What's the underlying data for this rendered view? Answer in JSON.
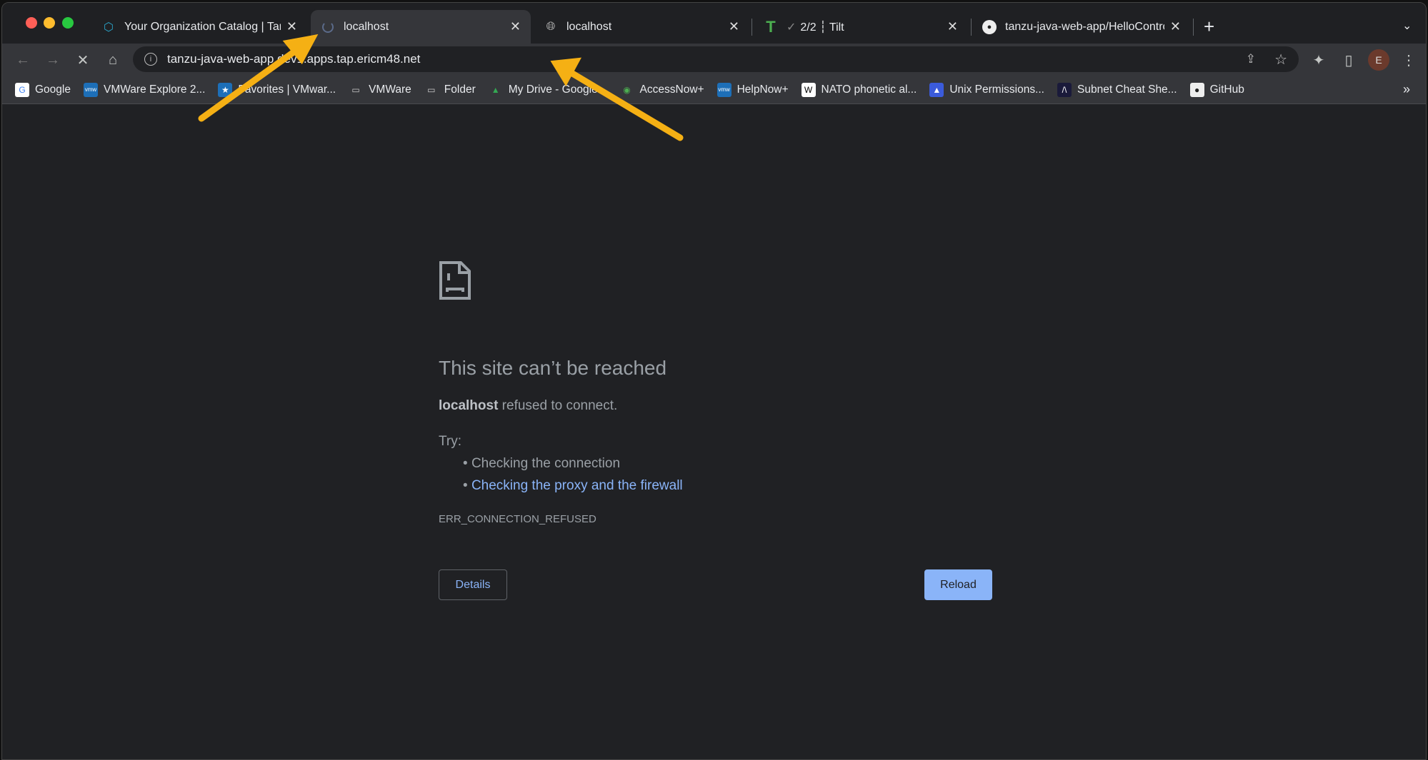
{
  "tabs": [
    {
      "title": "Your Organization Catalog | Tanzu",
      "icon": "tanzu-icon",
      "active": false
    },
    {
      "title": "localhost",
      "icon": "loading-spinner-icon",
      "active": true
    },
    {
      "title": "localhost",
      "icon": "globe-icon",
      "active": false
    },
    {
      "title": "2/2 ┆ Tilt",
      "prefix": "✓",
      "icon": "tilt-icon",
      "active": false
    },
    {
      "title": "tanzu-java-web-app/HelloController",
      "icon": "github-icon",
      "active": false
    }
  ],
  "toolbar": {
    "url": "tanzu-java-web-app.dev1.apps.tap.ericm48.net",
    "profile_initial": "E"
  },
  "bookmarks": [
    {
      "label": "Google",
      "icon": "google-icon"
    },
    {
      "label": "VMWare Explore 2...",
      "icon": "vmware-icon"
    },
    {
      "label": "Favorites | VMwar...",
      "icon": "favorites-icon"
    },
    {
      "label": "VMWare",
      "icon": "folder-icon"
    },
    {
      "label": "Folder",
      "icon": "folder-icon"
    },
    {
      "label": "My Drive - Google...",
      "icon": "google-drive-icon"
    },
    {
      "label": "AccessNow+",
      "icon": "accessnow-icon"
    },
    {
      "label": "HelpNow+",
      "icon": "vmware-icon"
    },
    {
      "label": "NATO phonetic al...",
      "icon": "wikipedia-icon"
    },
    {
      "label": "Unix Permissions...",
      "icon": "unix-icon"
    },
    {
      "label": "Subnet Cheat She...",
      "icon": "subnet-icon"
    },
    {
      "label": "GitHub",
      "icon": "github-icon"
    }
  ],
  "bookmarks_overflow": "»",
  "error": {
    "title": "This site can’t be reached",
    "host": "localhost",
    "message": " refused to connect.",
    "try_label": "Try:",
    "suggestions": [
      "Checking the connection",
      "Checking the proxy and the firewall"
    ],
    "code": "ERR_CONNECTION_REFUSED",
    "details_label": "Details",
    "reload_label": "Reload"
  },
  "colors": {
    "accent": "#8ab4f8",
    "annotation_arrow": "#f5b014",
    "background": "#202124"
  }
}
